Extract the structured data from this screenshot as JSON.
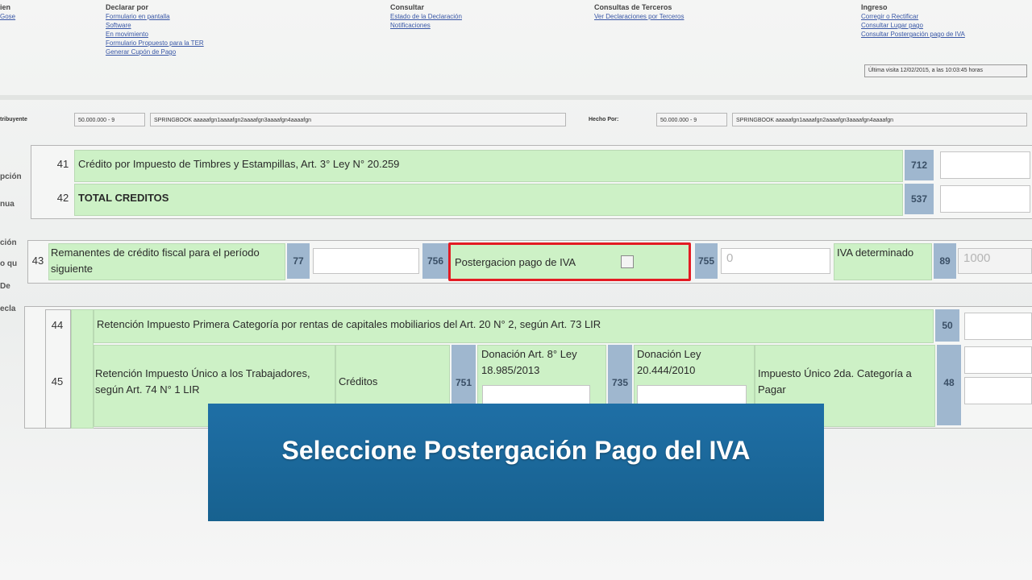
{
  "menu": {
    "col1": {
      "heading": "ien",
      "link": "Gose"
    },
    "declarar": {
      "heading": "Declarar por",
      "links": [
        "Formulario en pantalla",
        "Software",
        "En movimiento",
        "Formulario Propuesto para la TER",
        "Generar Cupón de Pago"
      ]
    },
    "consultar": {
      "heading": "Consultar",
      "links": [
        "Estado de la Declaración",
        "Notificaciones"
      ]
    },
    "terceros": {
      "heading": "Consultas de Terceros",
      "links": [
        "Ver Declaraciones por Terceros"
      ]
    },
    "ingreso": {
      "heading": "Ingreso",
      "links": [
        "Corregir o Rectificar",
        "Consultar Lugar pago",
        "Consultar Postergación pago de IVA"
      ]
    },
    "last_visit": "Última visita 12/02/2015, a las 10:03:45 horas"
  },
  "rut_row": {
    "left_label": "tribuyente",
    "left_rut": "50.000.000 - 9",
    "left_name": "SPRINGBOOK aaaaafgn1aaaafgn2aaaafgn3aaaafgn4aaaafgn",
    "right_label": "Hecho Por:",
    "right_rut": "50.000.000 - 9",
    "right_name": "SPRINGBOOK aaaaafgn1aaaafgn2aaaafgn3aaaafgn4aaaafgn"
  },
  "side_labels": [
    "pción",
    "nua",
    "ción",
    "o qu",
    "De",
    "ecla"
  ],
  "line41": {
    "num": "41",
    "text": "Crédito por Impuesto de Timbres y Estampillas, Art. 3° Ley N° 20.259",
    "code": "712"
  },
  "line42": {
    "num": "42",
    "text": "TOTAL CREDITOS",
    "code": "537"
  },
  "line43": {
    "num": "43",
    "text": "Remanentes de crédito fiscal para el período siguiente",
    "code1": "77",
    "code2": "756",
    "postergacion_label": "Postergacion pago de IVA",
    "code3": "755",
    "code3_value": "0",
    "iva_label": "IVA determinado",
    "code4": "89",
    "code4_value": "1000"
  },
  "line44": {
    "num": "44",
    "text": "Retención Impuesto Primera Categoría por rentas de capitales mobiliarios del Art. 20 N° 2, según Art. 73 LIR",
    "code": "50"
  },
  "line45": {
    "num": "45",
    "text": "Retención Impuesto Único a los Trabajadores, según Art. 74 N° 1 LIR",
    "creditos": "Créditos",
    "code_a": "751",
    "donacion1": "Donación Art. 8° Ley 18.985/2013",
    "code_b": "735",
    "donacion2": "Donación Ley 20.444/2010",
    "impuesto": "Impuesto Único 2da. Categoría a Pagar",
    "code_c": "48"
  },
  "caption": "Seleccione Postergación Pago del IVA"
}
